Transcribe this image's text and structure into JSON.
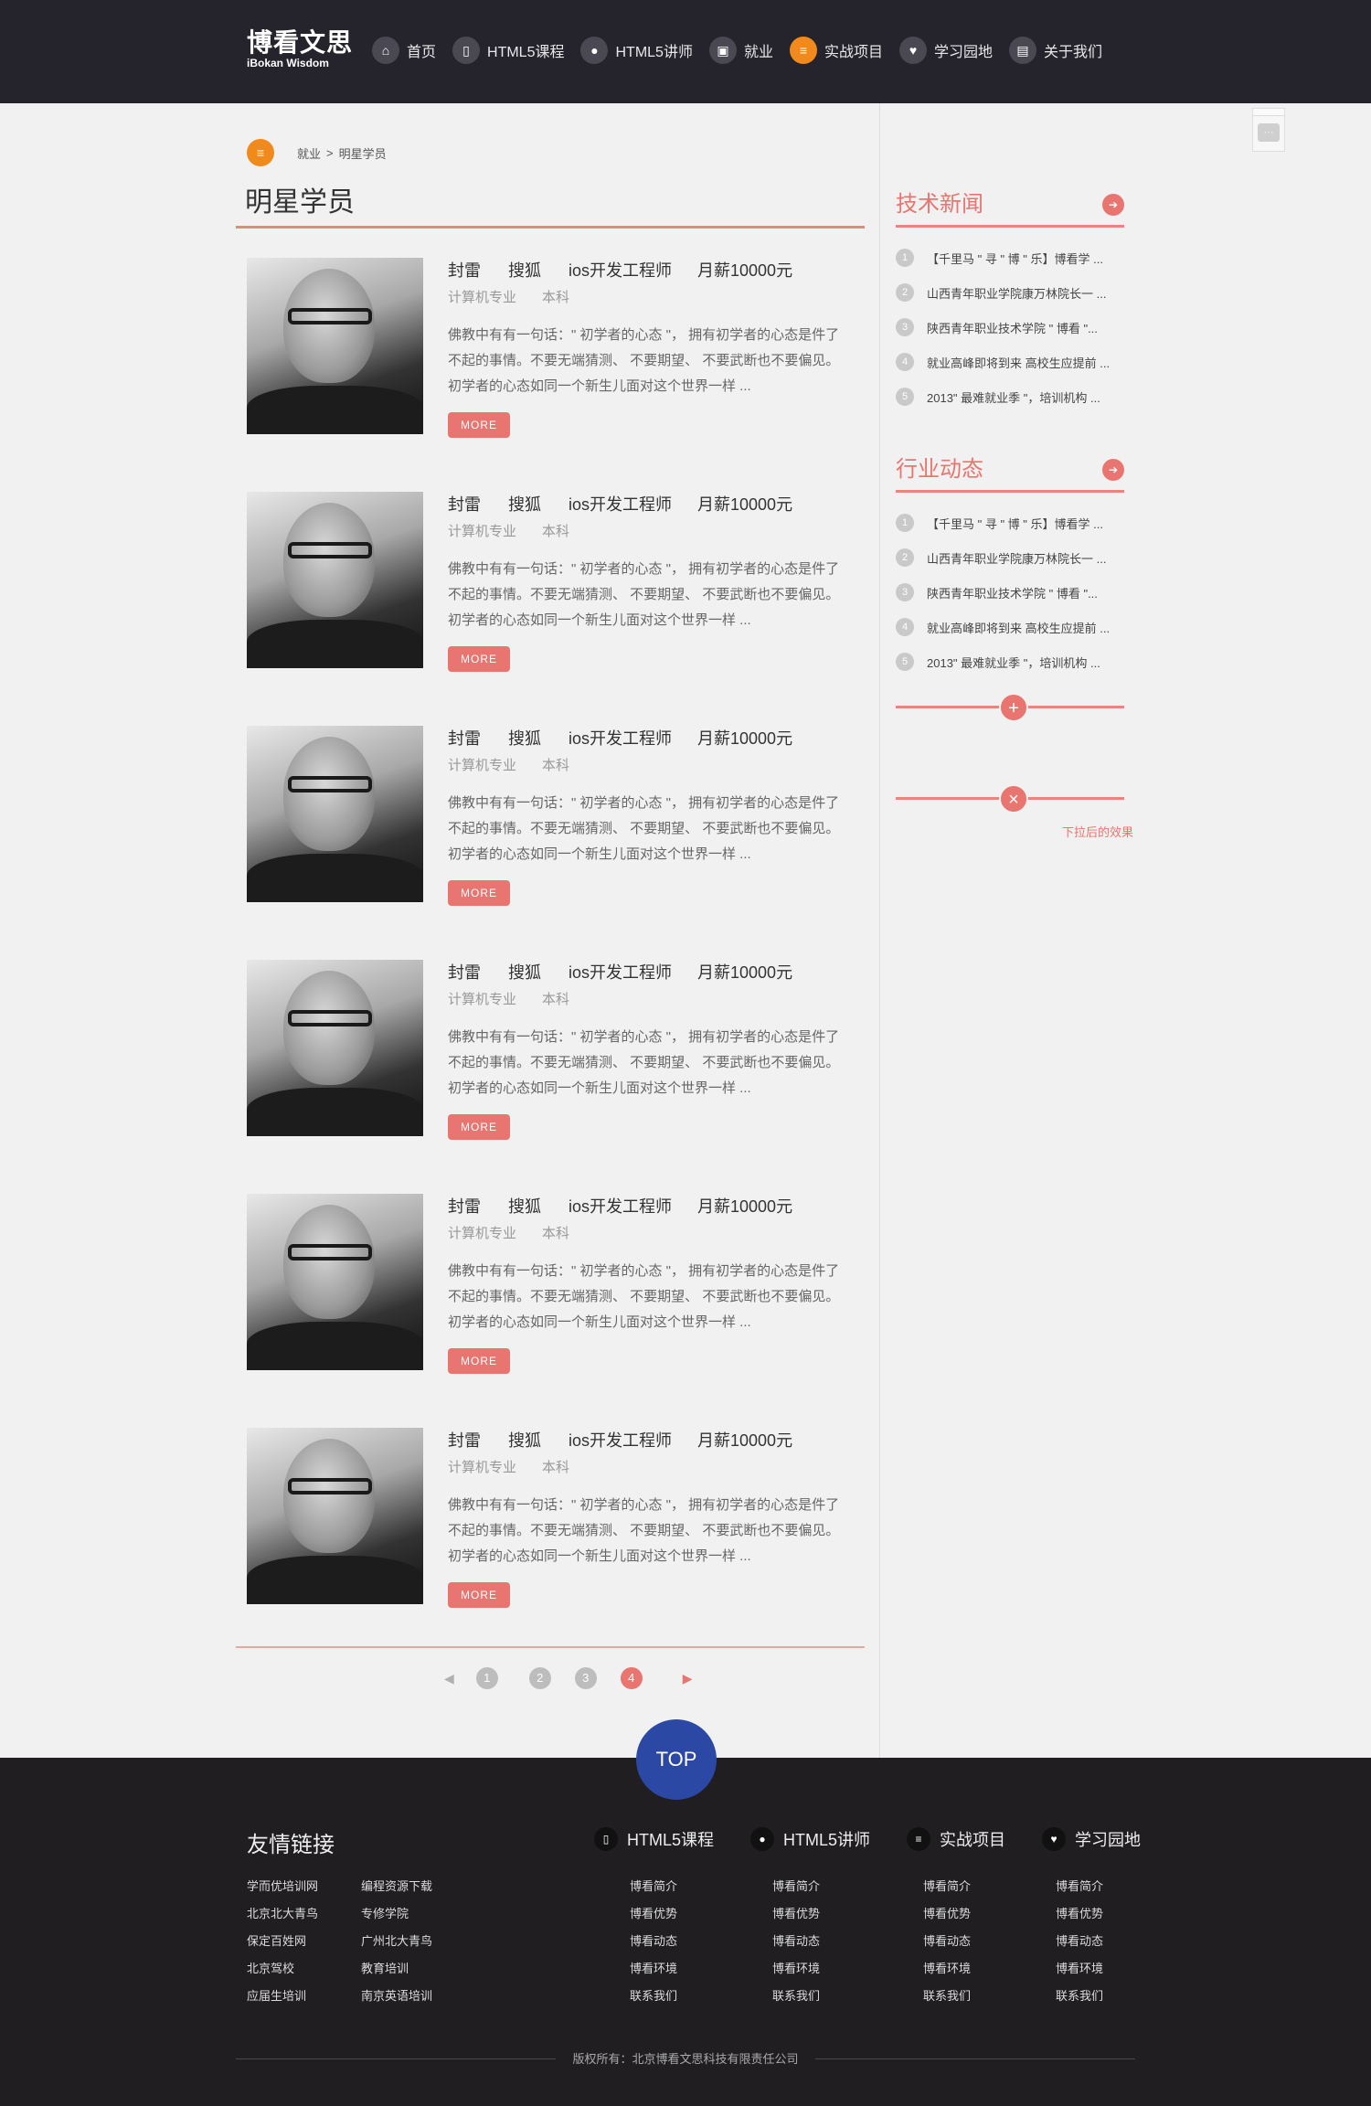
{
  "header": {
    "logo_cn": "博看文思",
    "logo_en": "iBokan Wisdom",
    "nav": [
      {
        "label": "首页",
        "icon": "home-icon",
        "glyph": "⌂"
      },
      {
        "label": "HTML5课程",
        "icon": "book-icon",
        "glyph": "▯"
      },
      {
        "label": "HTML5讲师",
        "icon": "teacher-icon",
        "glyph": "●"
      },
      {
        "label": "就业",
        "icon": "briefcase-icon",
        "glyph": "▣"
      },
      {
        "label": "实战项目",
        "icon": "database-icon",
        "glyph": "≡",
        "active": true
      },
      {
        "label": "学习园地",
        "icon": "heart-icon",
        "glyph": "♥"
      },
      {
        "label": "关于我们",
        "icon": "chat-icon",
        "glyph": "▤"
      }
    ]
  },
  "breadcrumb": {
    "parent": "就业",
    "separator": ">",
    "current": "明星学员"
  },
  "page_title": "明星学员",
  "students": [
    {
      "name": "封雷",
      "company": "搜狐",
      "job": "ios开发工程师",
      "salary": "月薪10000元",
      "major": "计算机专业",
      "degree": "本科",
      "desc": "佛教中有有一句话：\" 初学者的心态 \"， 拥有初学者的心态是件了不起的事情。不要无端猜测、 不要期望、 不要武断也不要偏见。初学者的心态如同一个新生儿面对这个世界一样 ...",
      "more": "MORE"
    },
    {
      "name": "封雷",
      "company": "搜狐",
      "job": "ios开发工程师",
      "salary": "月薪10000元",
      "major": "计算机专业",
      "degree": "本科",
      "desc": "佛教中有有一句话：\" 初学者的心态 \"， 拥有初学者的心态是件了不起的事情。不要无端猜测、 不要期望、 不要武断也不要偏见。初学者的心态如同一个新生儿面对这个世界一样 ...",
      "more": "MORE"
    },
    {
      "name": "封雷",
      "company": "搜狐",
      "job": "ios开发工程师",
      "salary": "月薪10000元",
      "major": "计算机专业",
      "degree": "本科",
      "desc": "佛教中有有一句话：\" 初学者的心态 \"， 拥有初学者的心态是件了不起的事情。不要无端猜测、 不要期望、 不要武断也不要偏见。初学者的心态如同一个新生儿面对这个世界一样 ...",
      "more": "MORE"
    },
    {
      "name": "封雷",
      "company": "搜狐",
      "job": "ios开发工程师",
      "salary": "月薪10000元",
      "major": "计算机专业",
      "degree": "本科",
      "desc": "佛教中有有一句话：\" 初学者的心态 \"， 拥有初学者的心态是件了不起的事情。不要无端猜测、 不要期望、 不要武断也不要偏见。初学者的心态如同一个新生儿面对这个世界一样 ...",
      "more": "MORE"
    },
    {
      "name": "封雷",
      "company": "搜狐",
      "job": "ios开发工程师",
      "salary": "月薪10000元",
      "major": "计算机专业",
      "degree": "本科",
      "desc": "佛教中有有一句话：\" 初学者的心态 \"， 拥有初学者的心态是件了不起的事情。不要无端猜测、 不要期望、 不要武断也不要偏见。初学者的心态如同一个新生儿面对这个世界一样 ...",
      "more": "MORE"
    },
    {
      "name": "封雷",
      "company": "搜狐",
      "job": "ios开发工程师",
      "salary": "月薪10000元",
      "major": "计算机专业",
      "degree": "本科",
      "desc": "佛教中有有一句话：\" 初学者的心态 \"， 拥有初学者的心态是件了不起的事情。不要无端猜测、 不要期望、 不要武断也不要偏见。初学者的心态如同一个新生儿面对这个世界一样 ...",
      "more": "MORE"
    }
  ],
  "pagination": {
    "prev": "◀",
    "next": "▶",
    "pages": [
      "1",
      "2",
      "3",
      "4"
    ],
    "active": "4"
  },
  "sidebar": {
    "tech_news": {
      "title": "技术新闻",
      "items": [
        "【千里马 \" 寻 \" 博 \" 乐】博看学 ...",
        "山西青年职业学院康万林院长一 ...",
        "陕西青年职业技术学院 \" 博看 \"...",
        "就业高峰即将到来 高校生应提前 ...",
        "2013\" 最难就业季 \"，培训机构 ..."
      ]
    },
    "industry": {
      "title": "行业动态",
      "items": [
        "【千里马 \" 寻 \" 博 \" 乐】博看学 ...",
        "山西青年职业学院康万林院长一 ...",
        "陕西青年职业技术学院 \" 博看 \"...",
        "就业高峰即将到来 高校生应提前 ...",
        "2013\" 最难就业季 \"，培训机构 ..."
      ]
    },
    "expand_glyph": "+",
    "collapse_glyph": "×",
    "expanded_note": "下拉后的效果"
  },
  "top_button": "TOP",
  "footer": {
    "links_title": "友情链接",
    "links": [
      [
        "学而优培训网",
        "编程资源下载"
      ],
      [
        "北京北大青鸟",
        "专修学院"
      ],
      [
        "保定百姓网",
        "广州北大青鸟"
      ],
      [
        "北京驾校",
        "教育培训"
      ],
      [
        "应届生培训",
        "南京英语培训"
      ]
    ],
    "categories": [
      {
        "label": "HTML5课程",
        "icon": "book-icon",
        "glyph": "▯"
      },
      {
        "label": "HTML5讲师",
        "icon": "teacher-icon",
        "glyph": "●"
      },
      {
        "label": "实战项目",
        "icon": "database-icon",
        "glyph": "≡"
      },
      {
        "label": "学习园地",
        "icon": "heart-icon",
        "glyph": "♥"
      }
    ],
    "columns": [
      [
        "博看简介",
        "博看优势",
        "博看动态",
        "博看环境",
        "联系我们"
      ],
      [
        "博看简介",
        "博看优势",
        "博看动态",
        "博看环境",
        "联系我们"
      ],
      [
        "博看简介",
        "博看优势",
        "博看动态",
        "博看环境",
        "联系我们"
      ],
      [
        "博看简介",
        "博看优势",
        "博看动态",
        "博看环境",
        "联系我们"
      ]
    ],
    "copyright": "版权所有：北京博看文思科技有限责任公司"
  }
}
